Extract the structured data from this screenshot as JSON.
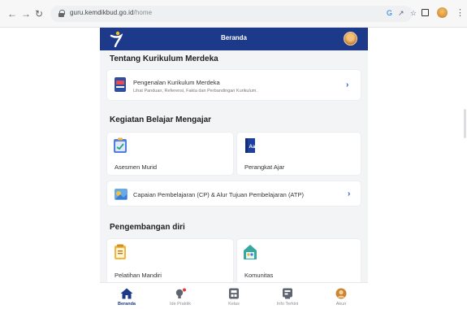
{
  "browser": {
    "url_domain": "guru.kemdikbud.go.id",
    "url_path": "/home"
  },
  "app": {
    "title": "Beranda",
    "sections": {
      "kurikulum": {
        "title": "Tentang Kurikulum Merdeka",
        "card": {
          "title": "Pengenalan Kurikulum Merdeka",
          "subtitle": "Lihat Panduan, Referensi, Fakta dan Perbandingan Kurikulum."
        }
      },
      "kegiatan": {
        "title": "Kegiatan Belajar Mengajar",
        "tiles": [
          {
            "label": "Asesmen Murid",
            "icon": "clipboard-icon"
          },
          {
            "label": "Perangkat Ajar",
            "icon": "book-icon"
          }
        ],
        "wide_card": {
          "title": "Capaian Pembelajaran (CP) & Alur Tujuan Pembelajaran (ATP)"
        }
      },
      "pengembangan": {
        "title": "Pengembangan diri",
        "tiles": [
          {
            "label": "Pelatihan Mandiri",
            "icon": "notepad-icon"
          },
          {
            "label": "Komunitas",
            "icon": "house-community-icon"
          }
        ]
      }
    },
    "bottom_nav": [
      {
        "label": "Beranda",
        "icon": "home-icon",
        "active": true
      },
      {
        "label": "Ide Praktik",
        "icon": "idea-icon",
        "active": false
      },
      {
        "label": "Kelas",
        "icon": "class-icon",
        "active": false
      },
      {
        "label": "Info Terkini",
        "icon": "news-icon",
        "active": false
      },
      {
        "label": "Akun",
        "icon": "account-icon",
        "active": false
      }
    ],
    "colors": {
      "header": "#1d3a8a",
      "accent": "#2f55c8",
      "background": "#f3f4f6"
    }
  }
}
